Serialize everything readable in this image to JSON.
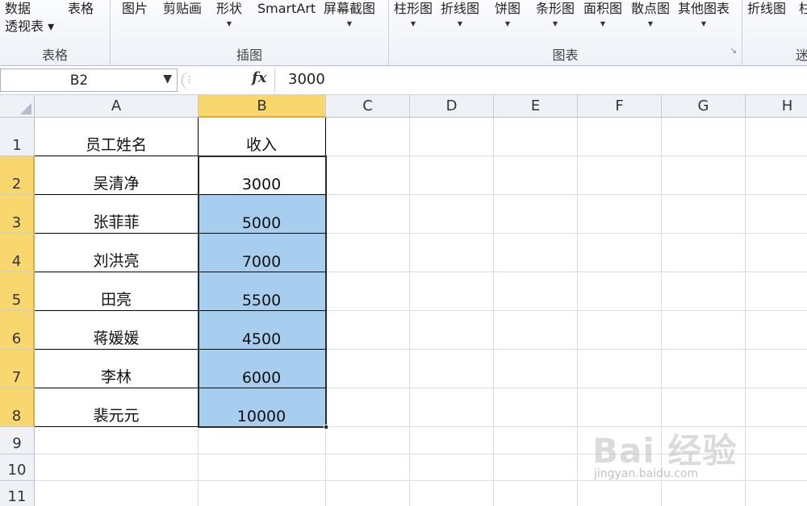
{
  "ribbon": {
    "groups": [
      {
        "label": "表格",
        "buttons": [
          {
            "line1": "数据",
            "line2": "透视表",
            "dropdown": true
          },
          {
            "line1": "表格",
            "line2": "",
            "dropdown": false
          }
        ]
      },
      {
        "label": "插图",
        "buttons": [
          {
            "line1": "图片",
            "line2": "",
            "dropdown": false
          },
          {
            "line1": "剪贴画",
            "line2": "",
            "dropdown": false
          },
          {
            "line1": "形状",
            "line2": "",
            "dropdown": true
          },
          {
            "line1": "SmartArt",
            "line2": "",
            "dropdown": false
          },
          {
            "line1": "屏幕截图",
            "line2": "",
            "dropdown": true
          }
        ]
      },
      {
        "label": "图表",
        "buttons": [
          {
            "line1": "柱形图",
            "line2": "",
            "dropdown": true
          },
          {
            "line1": "折线图",
            "line2": "",
            "dropdown": true
          },
          {
            "line1": "饼图",
            "line2": "",
            "dropdown": true
          },
          {
            "line1": "条形图",
            "line2": "",
            "dropdown": true
          },
          {
            "line1": "面积图",
            "line2": "",
            "dropdown": true
          },
          {
            "line1": "散点图",
            "line2": "",
            "dropdown": true
          },
          {
            "line1": "其他图表",
            "line2": "",
            "dropdown": true
          }
        ]
      },
      {
        "label": "迷",
        "buttons": [
          {
            "line1": "折线图",
            "line2": "",
            "dropdown": false
          },
          {
            "line1": "柱",
            "line2": "",
            "dropdown": false
          }
        ]
      }
    ]
  },
  "formula_bar": {
    "name_box": "B2",
    "fx_label": "fx",
    "value": "3000"
  },
  "sheet": {
    "columns": [
      "A",
      "B",
      "C",
      "D",
      "E",
      "F",
      "G",
      "H"
    ],
    "selected_column": "B",
    "rows": [
      "1",
      "2",
      "3",
      "4",
      "5",
      "6",
      "7",
      "8",
      "9",
      "10",
      "11"
    ],
    "selected_rows": [
      "2",
      "3",
      "4",
      "5",
      "6",
      "7",
      "8"
    ],
    "data": [
      [
        "员工姓名",
        "收入"
      ],
      [
        "吴清净",
        "3000"
      ],
      [
        "张菲菲",
        "5000"
      ],
      [
        "刘洪亮",
        "7000"
      ],
      [
        "田亮",
        "5500"
      ],
      [
        "蒋媛媛",
        "4500"
      ],
      [
        "李林",
        "6000"
      ],
      [
        "裴元元",
        "10000"
      ]
    ]
  },
  "colors": {
    "selection_fill": "#a7ceef",
    "header_highlight": "#f9d76f"
  },
  "watermark": {
    "text": "Bai 经验",
    "sub": "jingyan.baidu.com"
  }
}
